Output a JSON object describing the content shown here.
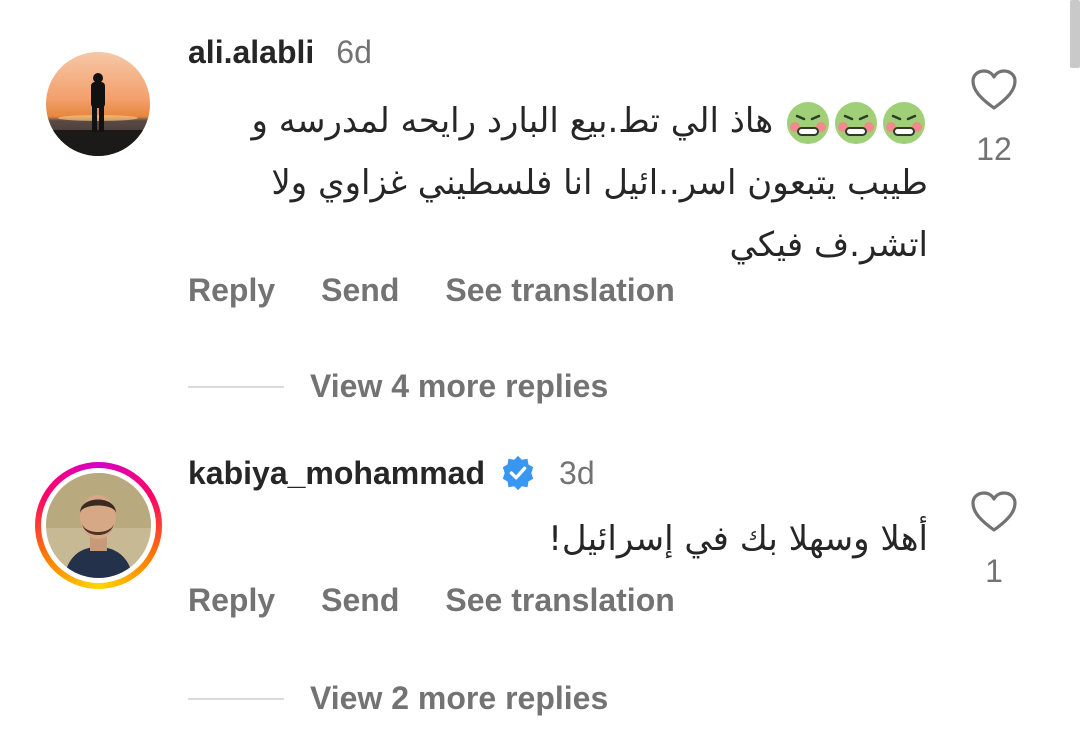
{
  "comments": [
    {
      "username": "ali.alabli",
      "time": "6d",
      "text_line1": "هاذ الي  تط.بيع البارد رايحه لمدرسه و",
      "text_line2": "طيبب يتبعون اسر..ائيل  انا فلسطيني غزاوي ولا",
      "text_line3": "اتشر.ف فيكي",
      "emoji_icon": "nauseated-face-icon",
      "like_count": "12",
      "reply_label": "Reply",
      "send_label": "Send",
      "translate_label": "See translation",
      "more_replies": "View 4 more replies"
    },
    {
      "username": "kabiya_mohammad",
      "time": "3d",
      "verified": true,
      "text_line1": "أهلا وسهلا بك في إسرائيل!",
      "like_count": "1",
      "reply_label": "Reply",
      "send_label": "Send",
      "translate_label": "See translation",
      "more_replies": "View 2 more replies"
    }
  ],
  "colors": {
    "text": "#262626",
    "secondary": "#737373",
    "verified": "#3897f0",
    "divider": "#dbdbdb"
  }
}
